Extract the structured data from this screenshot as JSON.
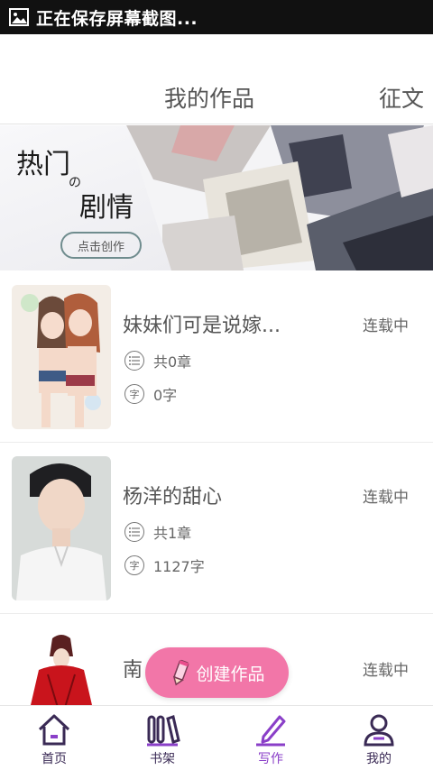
{
  "status_bar": {
    "text": "正在保存屏幕截图..."
  },
  "header": {
    "tabs": [
      {
        "label": "我的作品"
      },
      {
        "label": "征文"
      }
    ]
  },
  "banner": {
    "line1": "热门",
    "connector": "の",
    "line2": "剧情",
    "button": "点击创作"
  },
  "works": [
    {
      "title": "妹妹们可是说嫁...",
      "status": "连载中",
      "chapters": "共0章",
      "words": "0字"
    },
    {
      "title": "杨洋的甜心",
      "status": "连载中",
      "chapters": "共1章",
      "words": "1127字"
    },
    {
      "title": "南",
      "status": "连载中"
    }
  ],
  "fab": {
    "label": "创建作品"
  },
  "bottom_nav": [
    {
      "label": "首页"
    },
    {
      "label": "书架"
    },
    {
      "label": "写作"
    },
    {
      "label": "我的"
    }
  ],
  "word_icon_glyph": "字",
  "colors": {
    "accent_pink": "#f276a8",
    "nav_active": "#8a3fc8",
    "nav_inactive": "#3a2a55"
  }
}
